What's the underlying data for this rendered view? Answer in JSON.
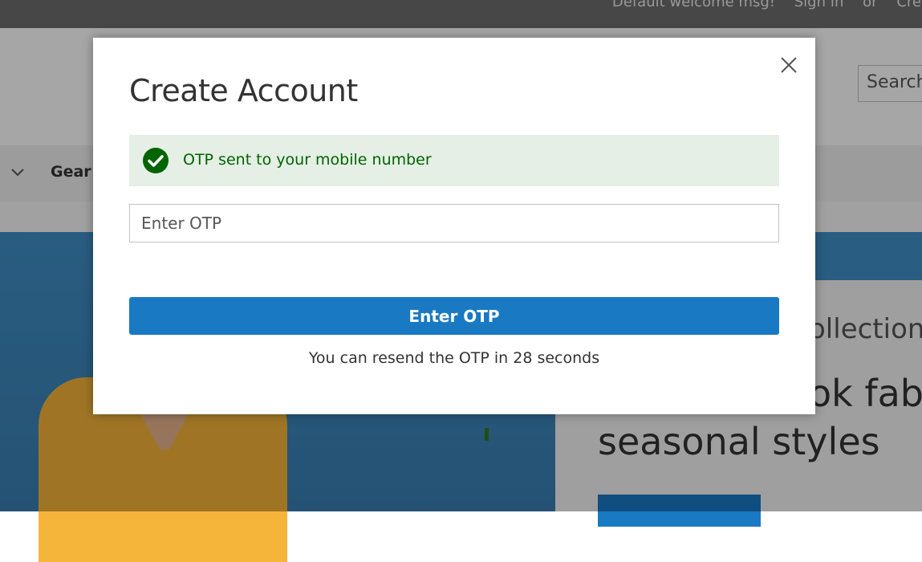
{
  "background": {
    "top_links": [
      "Default welcome msg!",
      "Sign In",
      "or",
      "Crea"
    ],
    "search_placeholder": "Search",
    "nav_item": "Gear",
    "hero": {
      "subtitle": "ollection",
      "title_line1": "ok fab",
      "title_line2": "seasonal styles"
    }
  },
  "modal": {
    "title": "Create Account",
    "close_icon": "close-icon",
    "alert": {
      "icon": "check-circle-icon",
      "message": "OTP sent to your mobile number",
      "color": "#006400"
    },
    "otp_input": {
      "placeholder": "Enter OTP",
      "value": ""
    },
    "submit_label": "Enter OTP",
    "resend_text": "You can resend the OTP in 28 seconds",
    "accent_color": "#1979c3"
  }
}
